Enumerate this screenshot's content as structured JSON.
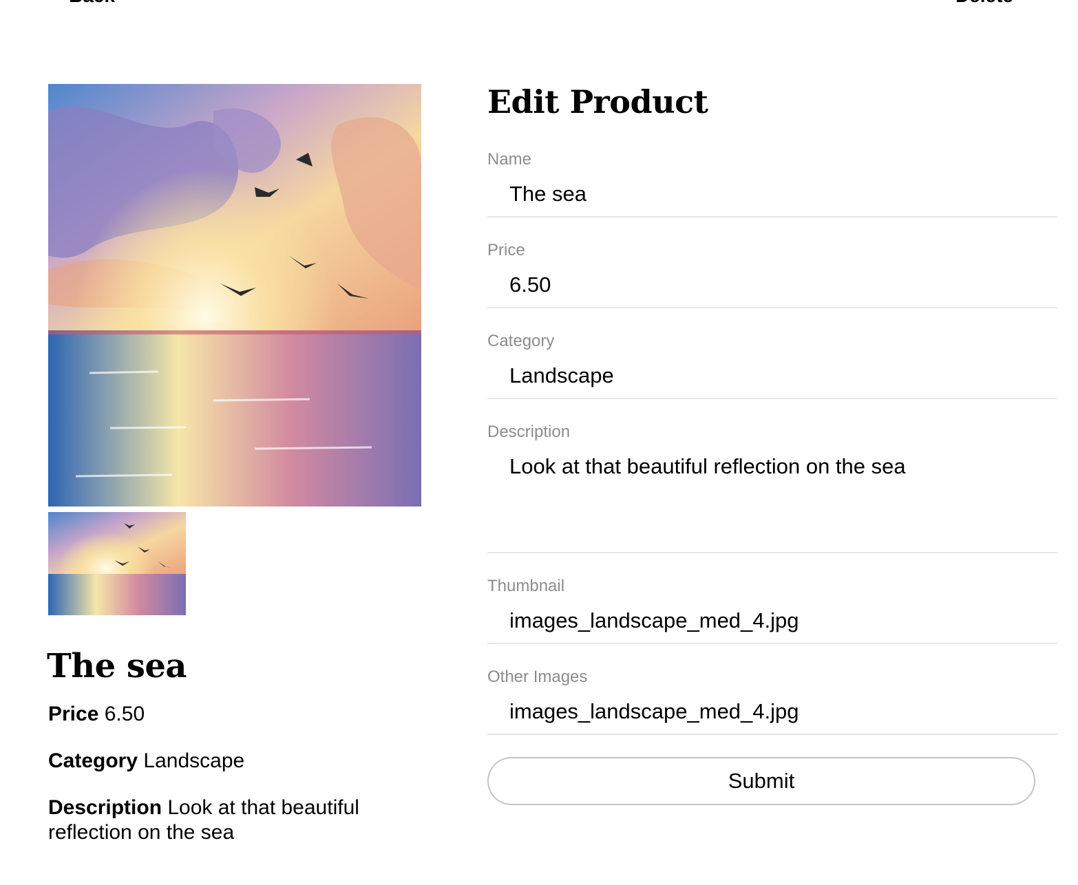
{
  "nav": {
    "back_label": "Back",
    "delete_label": "Delete"
  },
  "product": {
    "name": "The sea",
    "price_label": "Price",
    "price_value": "6.50",
    "category_label": "Category",
    "category_value": "Landscape",
    "description_label": "Description",
    "description_value": "Look at that beautiful reflection on the sea"
  },
  "form": {
    "title": "Edit Product",
    "fields": [
      {
        "label": "Name",
        "value": "The sea"
      },
      {
        "label": "Price",
        "value": "6.50"
      },
      {
        "label": "Category",
        "value": "Landscape"
      },
      {
        "label": "Description",
        "value": "Look at that beautiful reflection on the sea"
      },
      {
        "label": "Thumbnail",
        "value": "images_landscape_med_4.jpg"
      },
      {
        "label": "Other Images",
        "value": "images_landscape_med_4.jpg"
      }
    ],
    "submit_label": "Submit"
  },
  "colors": {
    "label_gray": "#8c8c8c",
    "divider": "#e6e6e6",
    "button_border": "#c4c4c4"
  }
}
